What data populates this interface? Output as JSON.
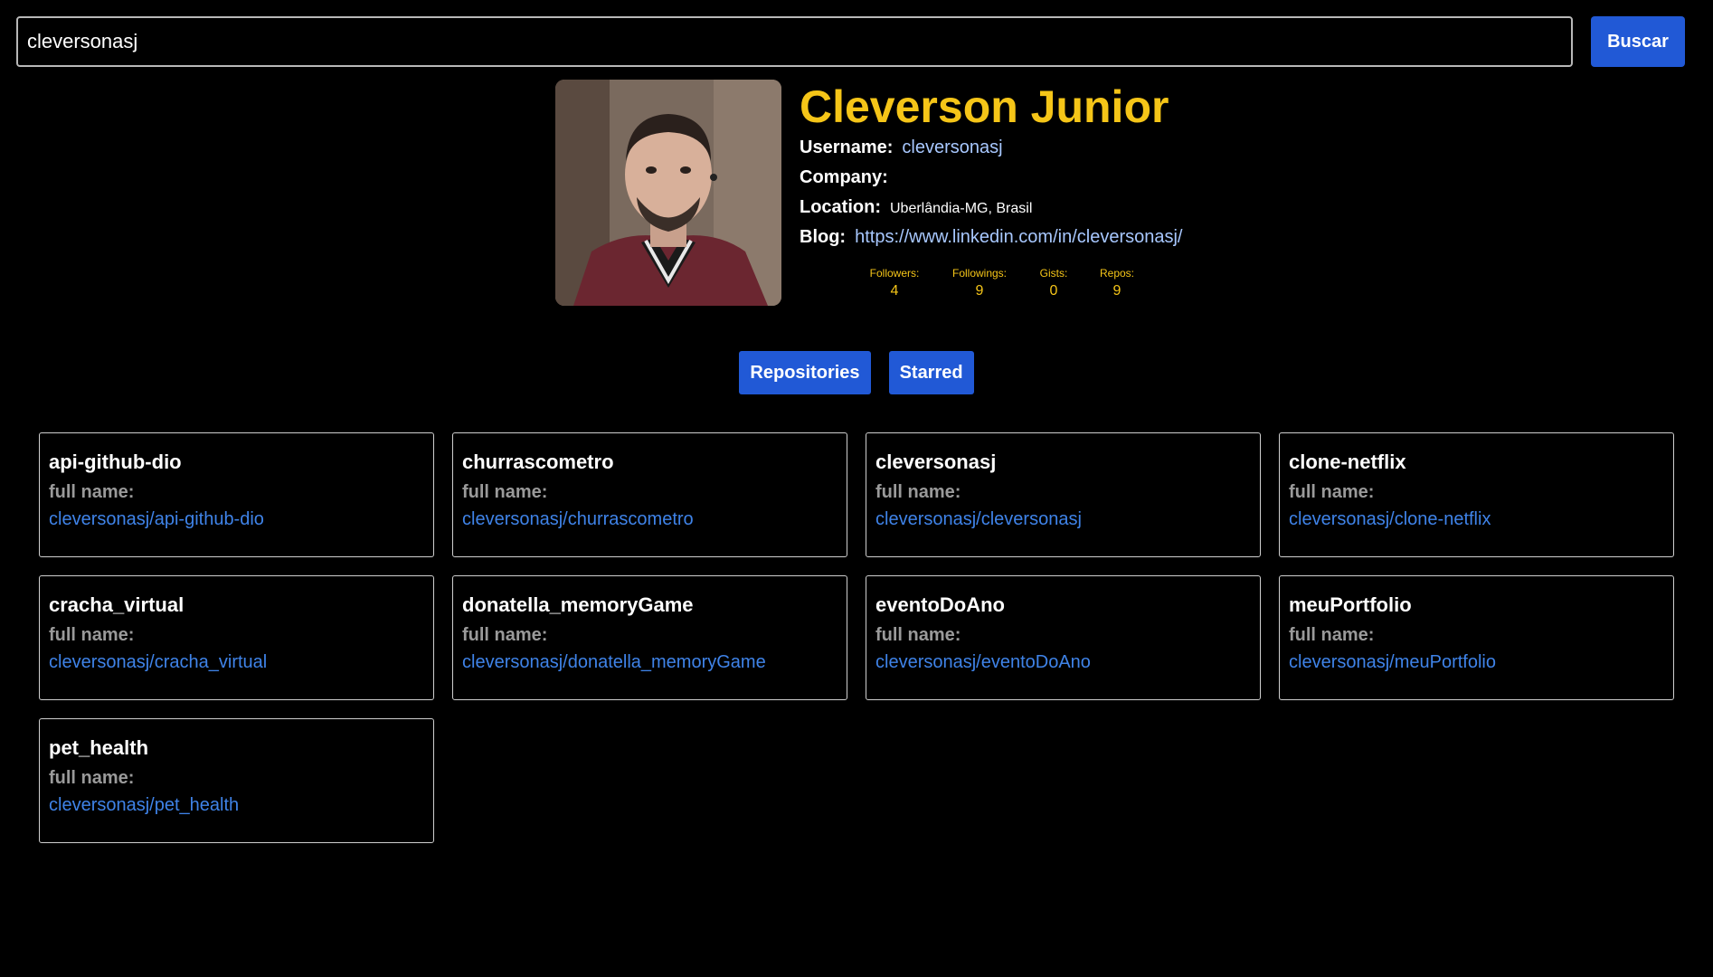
{
  "search": {
    "value": "cleversonasj",
    "button_label": "Buscar"
  },
  "profile": {
    "name": "Cleverson Junior",
    "username_label": "Username:",
    "username": "cleversonasj",
    "company_label": "Company:",
    "company": "",
    "location_label": "Location:",
    "location": "Uberlândia-MG, Brasil",
    "blog_label": "Blog:",
    "blog": "https://www.linkedin.com/in/cleversonasj/",
    "stats": [
      {
        "label": "Followers:",
        "value": "4"
      },
      {
        "label": "Followings:",
        "value": "9"
      },
      {
        "label": "Gists:",
        "value": "0"
      },
      {
        "label": "Repos:",
        "value": "9"
      }
    ]
  },
  "tabs": {
    "repositories": "Repositories",
    "starred": "Starred"
  },
  "repos": [
    {
      "name": "api-github-dio",
      "full_name_label": "full name:",
      "full_name": "cleversonasj/api-github-dio"
    },
    {
      "name": "churrascometro",
      "full_name_label": "full name:",
      "full_name": "cleversonasj/churrascometro"
    },
    {
      "name": "cleversonasj",
      "full_name_label": "full name:",
      "full_name": "cleversonasj/cleversonasj"
    },
    {
      "name": "clone-netflix",
      "full_name_label": "full name:",
      "full_name": "cleversonasj/clone-netflix"
    },
    {
      "name": "cracha_virtual",
      "full_name_label": "full name:",
      "full_name": "cleversonasj/cracha_virtual"
    },
    {
      "name": "donatella_memoryGame",
      "full_name_label": "full name:",
      "full_name": "cleversonasj/donatella_memoryGame"
    },
    {
      "name": "eventoDoAno",
      "full_name_label": "full name:",
      "full_name": "cleversonasj/eventoDoAno"
    },
    {
      "name": "meuPortfolio",
      "full_name_label": "full name:",
      "full_name": "cleversonasj/meuPortfolio"
    },
    {
      "name": "pet_health",
      "full_name_label": "full name:",
      "full_name": "cleversonasj/pet_health"
    }
  ],
  "colors": {
    "accent": "#2159d6",
    "name": "#f5c518",
    "link": "#3f83e8"
  }
}
